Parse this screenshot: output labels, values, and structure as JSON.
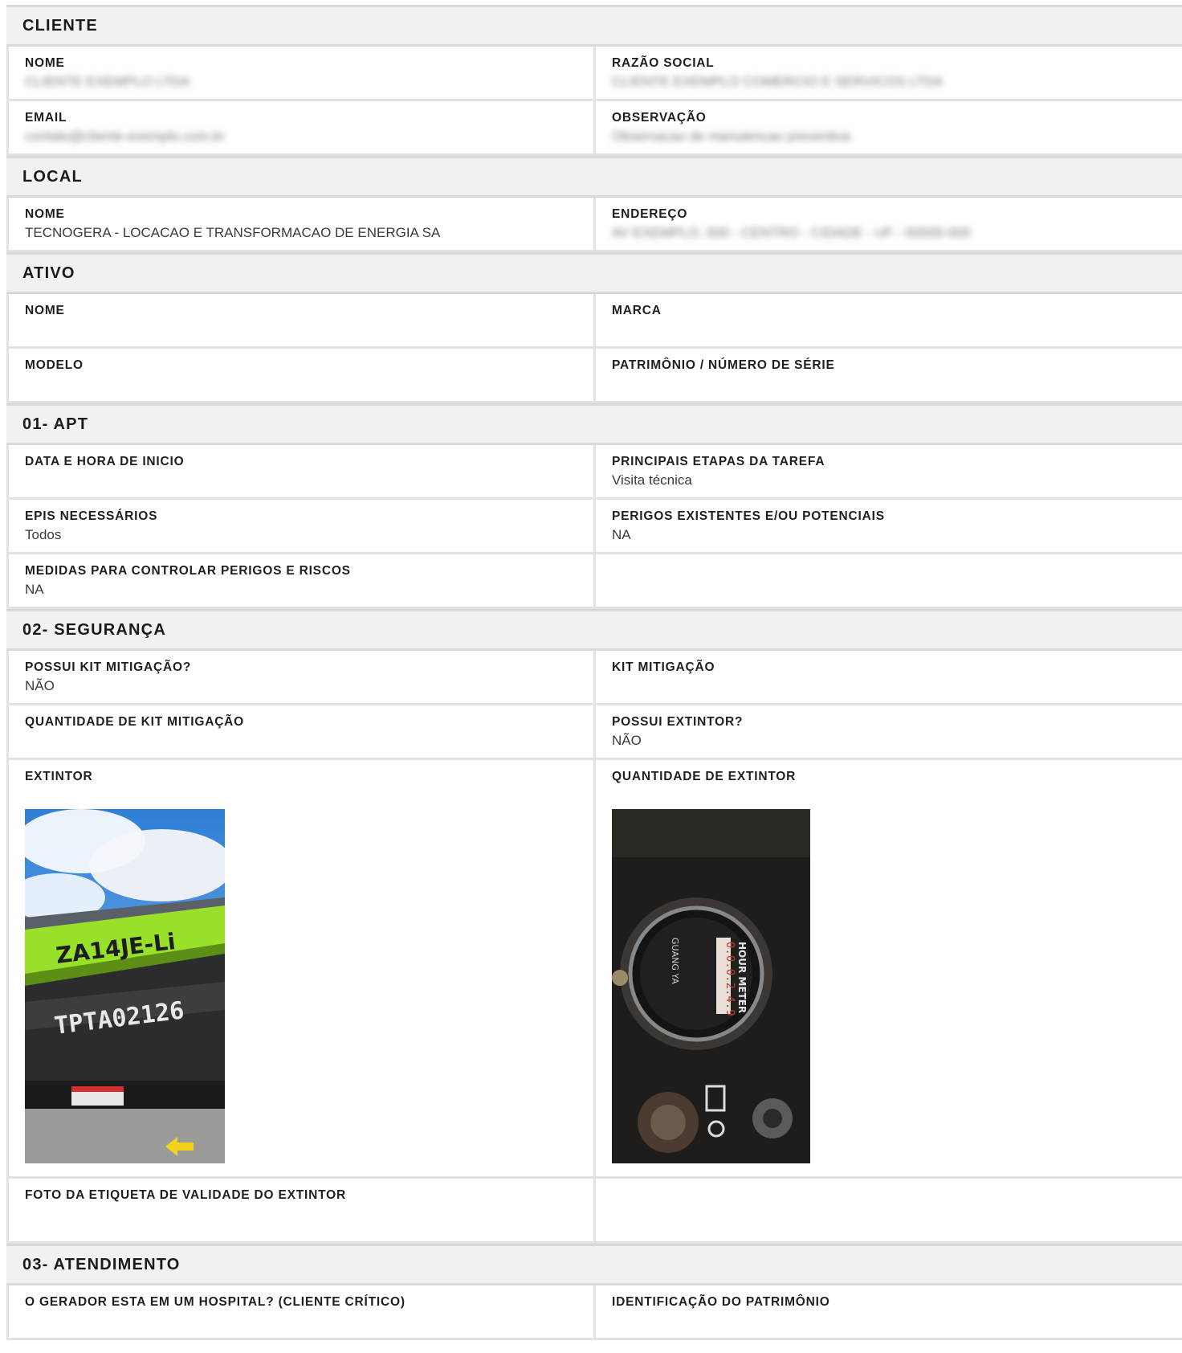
{
  "sections": {
    "cliente": {
      "title": "CLIENTE",
      "nome_label": "NOME",
      "nome_value": "CLIENTE EXEMPLO LTDA",
      "razao_label": "RAZÃO SOCIAL",
      "razao_value": "CLIENTE EXEMPLO COMERCIO E SERVICOS LTDA",
      "email_label": "EMAIL",
      "email_value": "contato@cliente-exemplo.com.br",
      "obs_label": "OBSERVAÇÃO",
      "obs_value": "Observacao de manutencao preventiva"
    },
    "local": {
      "title": "LOCAL",
      "nome_label": "NOME",
      "nome_value": "TECNOGERA - LOCACAO E TRANSFORMACAO DE ENERGIA SA",
      "endereco_label": "ENDEREÇO",
      "endereco_value": "AV EXEMPLO, 000 - CENTRO - CIDADE - UF - 00000-000"
    },
    "ativo": {
      "title": "ATIVO",
      "nome_label": "NOME",
      "marca_label": "MARCA",
      "modelo_label": "MODELO",
      "patrimonio_label": "PATRIMÔNIO / NÚMERO DE SÉRIE"
    },
    "apt": {
      "title": "01- APT",
      "data_label": "DATA E HORA DE INICIO",
      "etapas_label": "PRINCIPAIS ETAPAS DA TAREFA",
      "etapas_value": "Visita técnica",
      "epis_label": "EPIS NECESSÁRIOS",
      "epis_value": "Todos",
      "perigos_label": "PERIGOS EXISTENTES E/OU POTENCIAIS",
      "perigos_value": "NA",
      "medidas_label": "MEDIDAS PARA CONTROLAR PERIGOS E RISCOS",
      "medidas_value": "NA"
    },
    "seguranca": {
      "title": "02- SEGURANÇA",
      "possui_kit_label": "POSSUI KIT MITIGAÇÃO?",
      "possui_kit_value": "NÃO",
      "kit_label": "KIT MITIGAÇÃO",
      "qtd_kit_label": "QUANTIDADE DE KIT MITIGAÇÃO",
      "possui_extintor_label": "POSSUI EXTINTOR?",
      "possui_extintor_value": "NÃO",
      "extintor_label": "EXTINTOR",
      "qtd_extintor_label": "QUANTIDADE DE EXTINTOR",
      "foto_label": "FOTO DA ETIQUETA DE VALIDADE DO EXTINTOR",
      "photo1": {
        "model_text": "ZA14JE-Li",
        "plate_text": "TPTA02126"
      },
      "photo2": {
        "meter_text": "HOUR METER",
        "brand_text": "GUANG YA",
        "reading": "0.0.0.2.4.9"
      }
    },
    "atendimento": {
      "title": "03- ATENDIMENTO",
      "hospital_label": "O GERADOR ESTA EM UM HOSPITAL? (CLIENTE CRÍTICO)",
      "identificacao_label": "IDENTIFICAÇÃO DO PATRIMÔNIO"
    }
  },
  "colors": {
    "header_bg": "#f1f1f1",
    "border": "#e2e2e2",
    "machine_green": "#9be22b"
  }
}
